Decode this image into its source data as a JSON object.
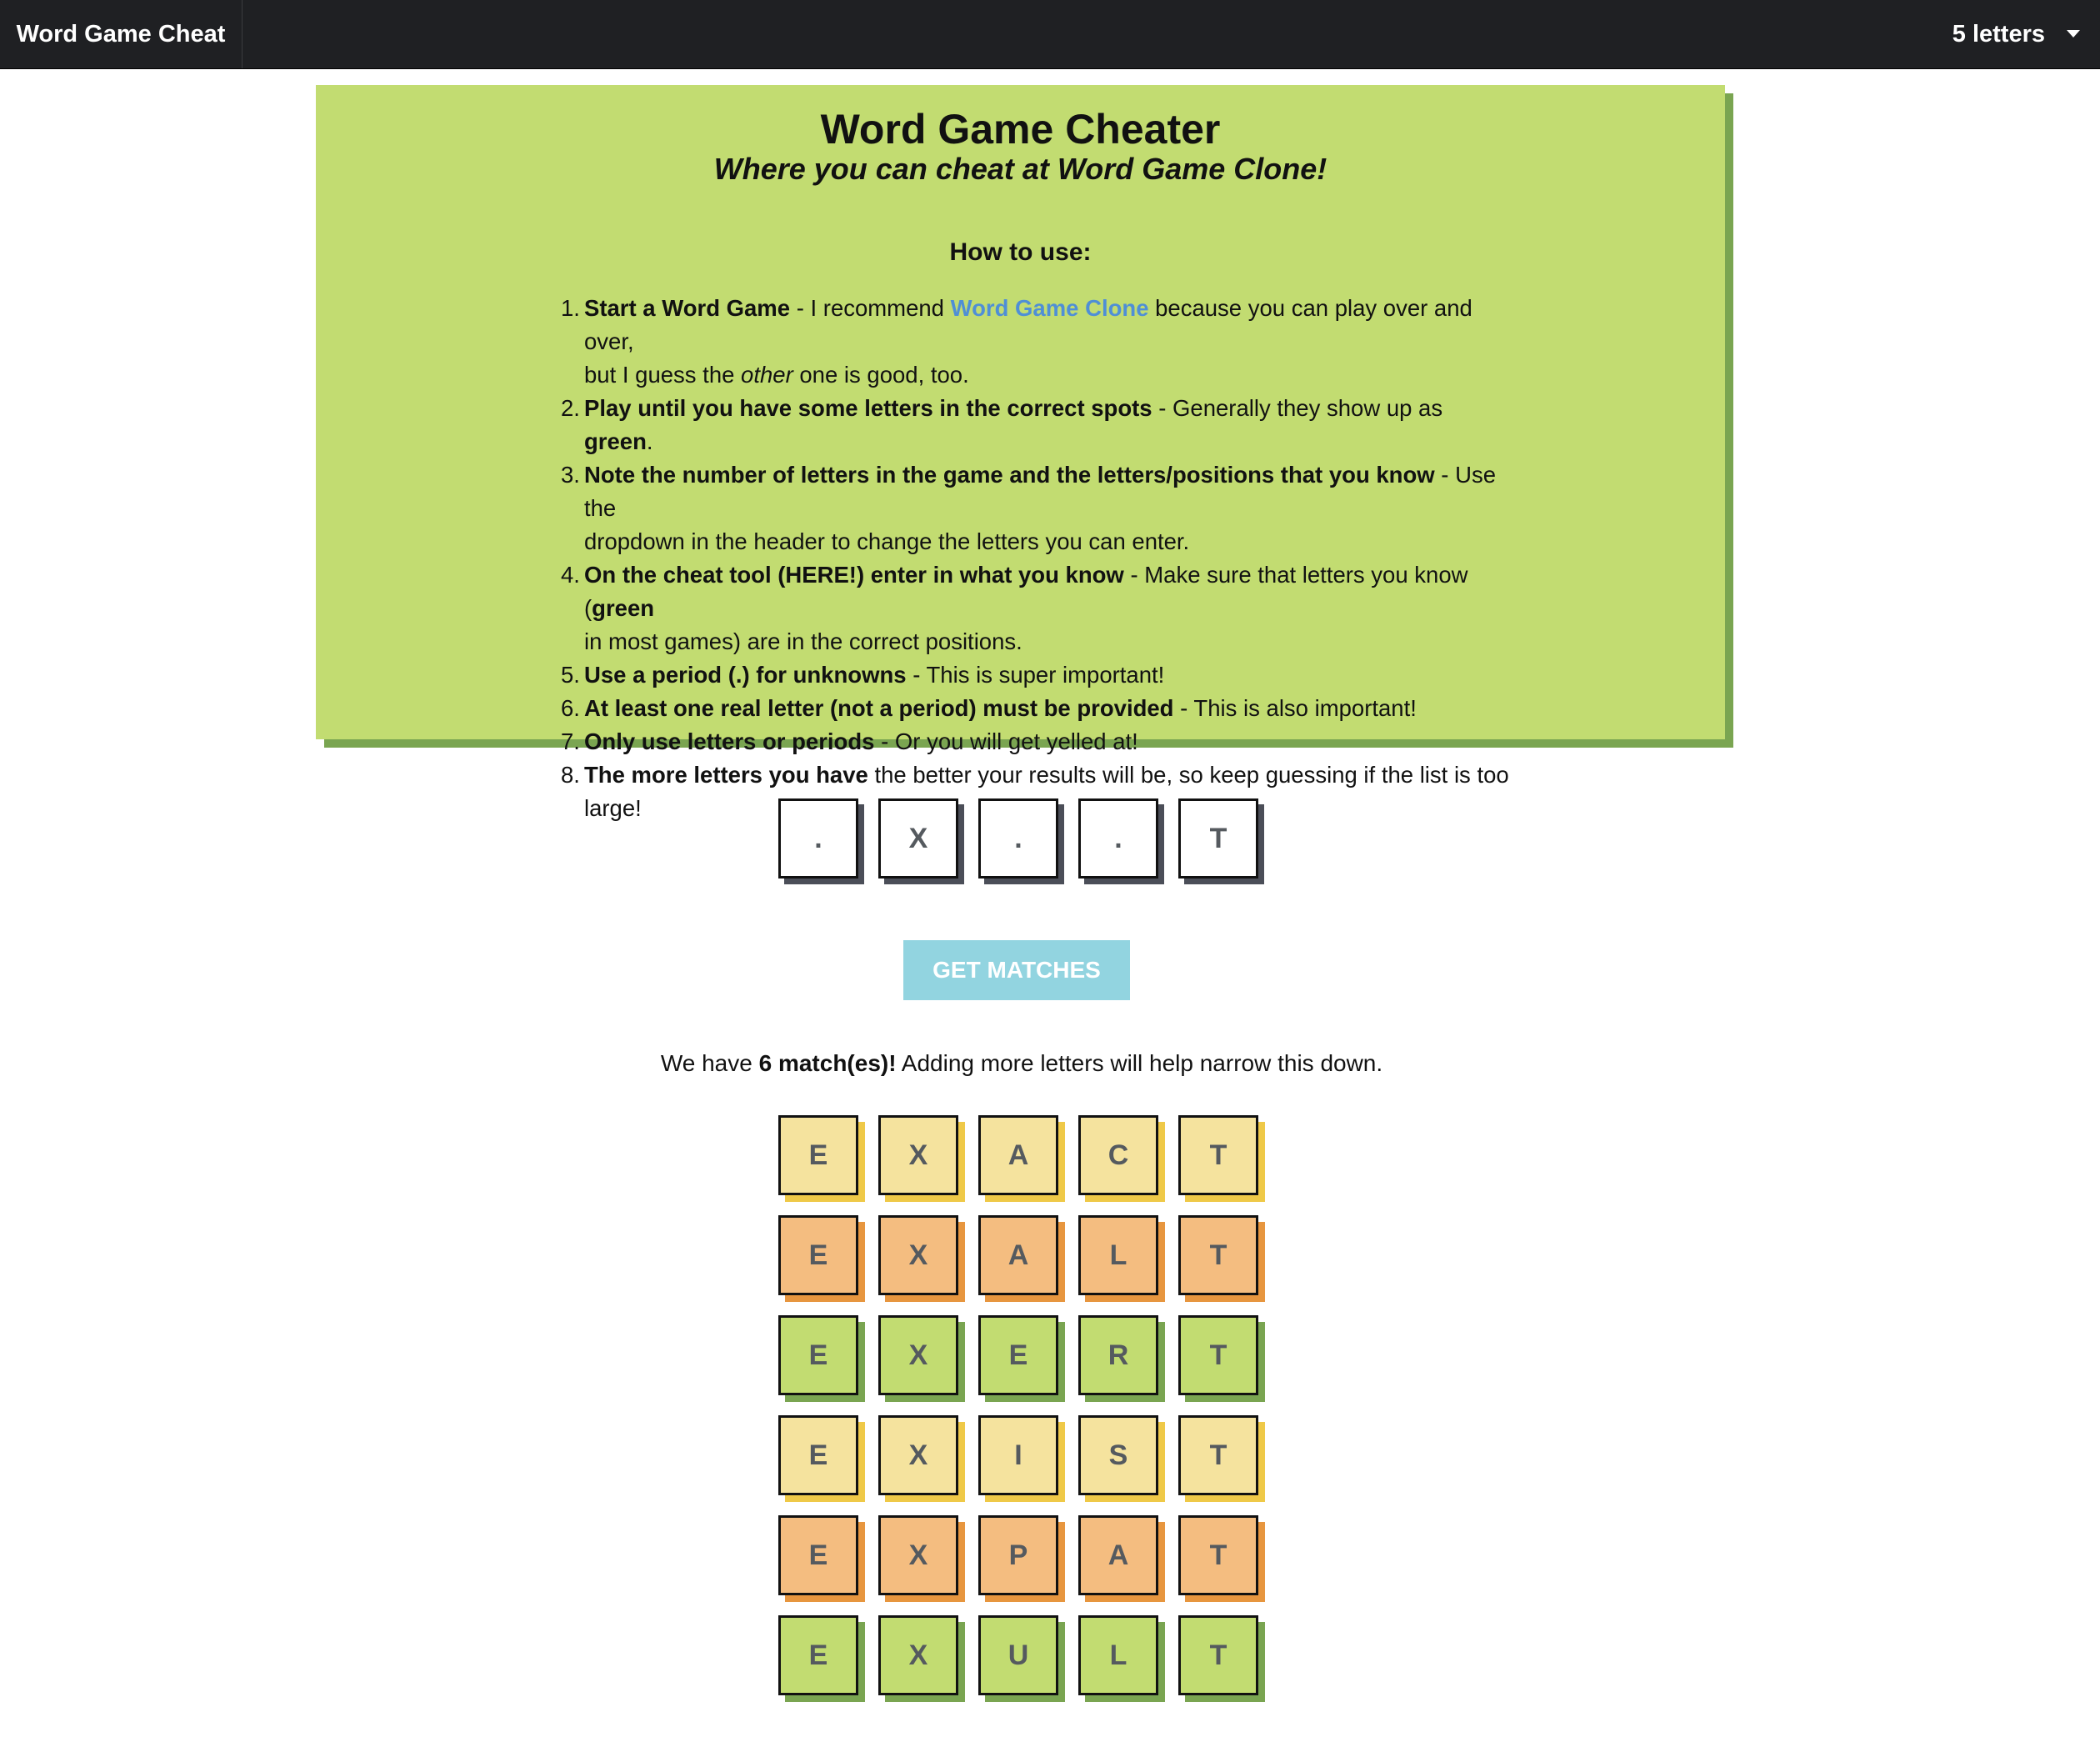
{
  "header": {
    "brand": "Word Game Cheat",
    "letters_select": "5 letters"
  },
  "card": {
    "title": "Word Game Cheater",
    "subtitle": "Where you can cheat at Word Game Clone!",
    "howto": "How to use:",
    "steps": [
      {
        "num": "1.",
        "bold": "Start a Word Game",
        "text_a": " - I recommend ",
        "link": "Word Game Clone",
        "text_b": " because you can play over and over,",
        "line2_a": "but I guess the ",
        "line2_italic": "other",
        "line2_b": " one is good, too."
      },
      {
        "num": "2.",
        "bold": "Play until you have some letters in the correct spots",
        "text_a": " - Generally they show up as ",
        "bold2": "green",
        "text_b": "."
      },
      {
        "num": "3.",
        "bold": "Note the number of letters in the game and the letters/positions that you know",
        "text_a": " - Use the",
        "line2": "dropdown in the header to change the letters you can enter."
      },
      {
        "num": "4.",
        "bold": "On the cheat tool (HERE!) enter in what you know",
        "text_a": " - Make sure that letters you know (",
        "bold2": "green",
        "line2": "in most games) are in the correct positions."
      },
      {
        "num": "5.",
        "bold": "Use a period (.) for unknowns",
        "text_a": " - This is super important!"
      },
      {
        "num": "6.",
        "bold": "At least one real letter (not a period) must be provided",
        "text_a": " - This is also important!"
      },
      {
        "num": "7.",
        "bold": "Only use letters or periods",
        "text_a": " - Or you will get yelled at!"
      },
      {
        "num": "8.",
        "bold": "The more letters you have",
        "text_a": " the better your results will be, so keep guessing if the list is too",
        "line2": "large!"
      }
    ]
  },
  "input": {
    "tiles": [
      ".",
      "X",
      ".",
      ".",
      "T"
    ]
  },
  "button": {
    "label": "GET MATCHES"
  },
  "results": {
    "prefix": "We have ",
    "count": "6 match(es)!",
    "suffix": " Adding more letters will help narrow this down.",
    "words": [
      {
        "letters": [
          "E",
          "X",
          "A",
          "C",
          "T"
        ],
        "color": "yellow"
      },
      {
        "letters": [
          "E",
          "X",
          "A",
          "L",
          "T"
        ],
        "color": "orange"
      },
      {
        "letters": [
          "E",
          "X",
          "E",
          "R",
          "T"
        ],
        "color": "green"
      },
      {
        "letters": [
          "E",
          "X",
          "I",
          "S",
          "T"
        ],
        "color": "yellow"
      },
      {
        "letters": [
          "E",
          "X",
          "P",
          "A",
          "T"
        ],
        "color": "orange"
      },
      {
        "letters": [
          "E",
          "X",
          "U",
          "L",
          "T"
        ],
        "color": "green"
      }
    ]
  },
  "colors": {
    "header_bg": "#1f2023",
    "card_bg": "#c2dc71",
    "card_shadow": "#7aa551",
    "link": "#4f8fd6",
    "button_bg": "#92d4e0",
    "tile_yellow": "#f5e39e",
    "tile_orange": "#f4bd80",
    "tile_green": "#c2dc71"
  }
}
